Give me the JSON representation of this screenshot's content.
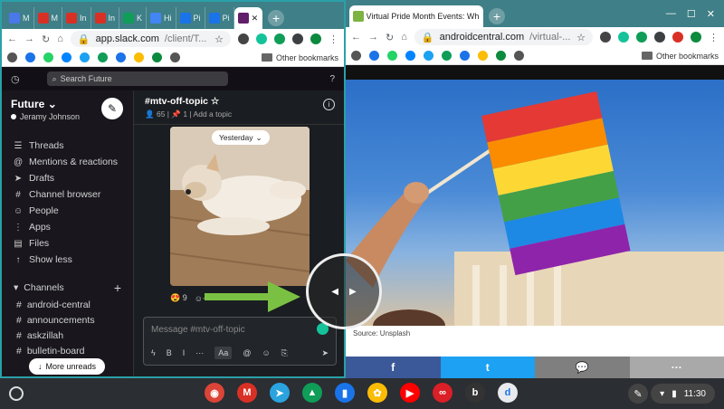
{
  "left_window": {
    "tabs": [
      {
        "label": "M",
        "color": "#4a78e8"
      },
      {
        "label": "M",
        "color": "#d93025"
      },
      {
        "label": "In",
        "color": "#d93025"
      },
      {
        "label": "In",
        "color": "#d93025"
      },
      {
        "label": "K",
        "color": "#0f9d58"
      },
      {
        "label": "Hi",
        "color": "#4285f4"
      },
      {
        "label": "Pi",
        "color": "#1a73e8"
      },
      {
        "label": "Pi",
        "color": "#1a73e8"
      }
    ],
    "active_tab": {
      "label": "",
      "color": "#611f69"
    },
    "address": {
      "host": "app.slack.com",
      "path": "/client/T..."
    }
  },
  "right_window": {
    "tab_title": "Virtual Pride Month Events: Whe",
    "address": {
      "host": "androidcentral.com",
      "path": "/virtual-..."
    }
  },
  "bookmarks": {
    "other_label": "Other bookmarks"
  },
  "slack": {
    "search_placeholder": "Search Future",
    "workspace": {
      "name": "Future",
      "user": "Jeramy Johnson"
    },
    "nav": [
      {
        "label": "Threads",
        "icon": "threads-icon",
        "glyph": "☰"
      },
      {
        "label": "Mentions & reactions",
        "icon": "mentions-icon",
        "glyph": "@"
      },
      {
        "label": "Drafts",
        "icon": "drafts-icon",
        "glyph": "➤"
      },
      {
        "label": "Channel browser",
        "icon": "channel-browser-icon",
        "glyph": "#"
      },
      {
        "label": "People",
        "icon": "people-icon",
        "glyph": "☺"
      },
      {
        "label": "Apps",
        "icon": "apps-icon",
        "glyph": "⋮"
      },
      {
        "label": "Files",
        "icon": "files-icon",
        "glyph": "▤"
      },
      {
        "label": "Show less",
        "icon": "arrow-up-icon",
        "glyph": "↑"
      }
    ],
    "channels_header": "Channels",
    "channels": [
      "android-central",
      "announcements",
      "askzillah",
      "bulletin-board"
    ],
    "more_unreads": "More unreads",
    "channel": {
      "name": "#mtv-off-topic",
      "members": "65",
      "pins": "1",
      "add_topic": "Add a topic"
    },
    "date_divider": "Yesterday",
    "reaction_count": "9",
    "message_placeholder": "Message #mtv-off-topic",
    "format_tools": [
      "B",
      "I",
      "···",
      "Aa",
      "@",
      "☺",
      "⎘",
      "➤"
    ]
  },
  "article": {
    "caption": "Source: Unsplash",
    "share": [
      {
        "label": "f",
        "color": "#3b5998",
        "icon": "facebook-icon"
      },
      {
        "label": "t",
        "color": "#1da1f2",
        "icon": "twitter-icon"
      },
      {
        "label": "💬",
        "color": "#7f7f7f",
        "icon": "message-icon"
      },
      {
        "label": "···",
        "color": "#a9a9a9",
        "icon": "more-icon"
      }
    ]
  },
  "shelf": {
    "apps": [
      {
        "name": "chrome-icon",
        "color": "#db4437",
        "glyph": "◉"
      },
      {
        "name": "gmail-icon",
        "color": "#d93025",
        "glyph": "M"
      },
      {
        "name": "telegram-icon",
        "color": "#2aa3df",
        "glyph": "➤"
      },
      {
        "name": "drive-icon",
        "color": "#0f9d58",
        "glyph": "▲"
      },
      {
        "name": "files-icon",
        "color": "#1a73e8",
        "glyph": "▮"
      },
      {
        "name": "photos-icon",
        "color": "#fbbc04",
        "glyph": "✿"
      },
      {
        "name": "youtube-icon",
        "color": "#ff0000",
        "glyph": "▶"
      },
      {
        "name": "creative-cloud-icon",
        "color": "#da1f26",
        "glyph": "∞"
      },
      {
        "name": "blackboard-icon",
        "color": "#333333",
        "glyph": "b"
      },
      {
        "name": "dictionary-icon",
        "color": "#e8eaed",
        "glyph": "d"
      }
    ],
    "time": "11:30"
  }
}
